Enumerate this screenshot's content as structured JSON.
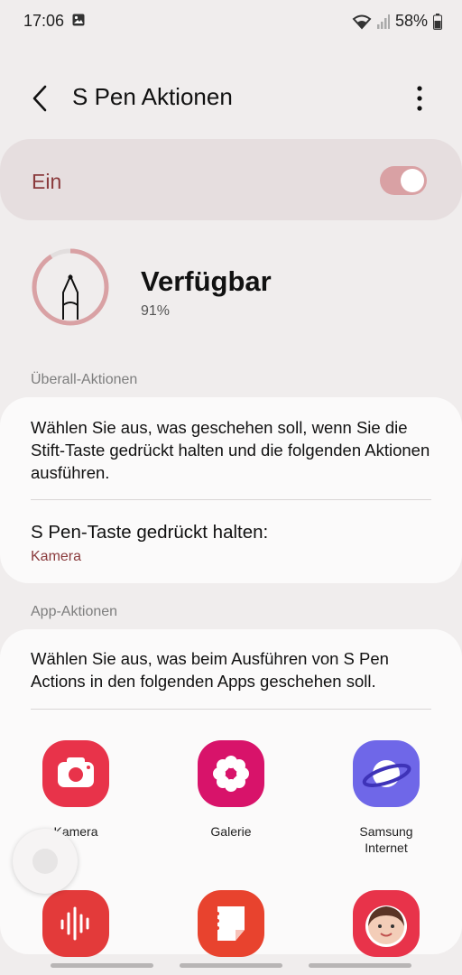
{
  "status": {
    "time": "17:06",
    "battery": "58%"
  },
  "header": {
    "title": "S Pen Aktionen"
  },
  "master": {
    "label": "Ein",
    "on": true
  },
  "availability": {
    "title": "Verfügbar",
    "percent": "91%"
  },
  "sections": {
    "anywhere": "Überall-Aktionen",
    "app": "App-Aktionen"
  },
  "anywhere_card": {
    "description": "Wählen Sie aus, was geschehen soll, wenn Sie die Stift-Taste gedrückt halten und die folgenden Aktionen ausführen.",
    "row_title": "S Pen-Taste gedrückt halten:",
    "row_value": "Kamera"
  },
  "app_card": {
    "description": "Wählen Sie aus, was beim Ausführen von S Pen Actions in den folgenden Apps geschehen soll.",
    "apps": [
      {
        "label": "Kamera",
        "icon": "camera-icon",
        "color": "#e8334a"
      },
      {
        "label": "Galerie",
        "icon": "flower-icon",
        "color": "#d8136a"
      },
      {
        "label": "Samsung\nInternet",
        "icon": "planet-icon",
        "color": "#6f67e8"
      },
      {
        "label": "",
        "icon": "voice-recorder-icon",
        "color": "#e33a3a"
      },
      {
        "label": "",
        "icon": "notes-icon",
        "color": "#e8432e"
      },
      {
        "label": "",
        "icon": "ar-emoji-icon",
        "color": "#e8334a"
      }
    ]
  },
  "colors": {
    "accent": "#8a3a3c",
    "toggle_on": "#d9a1a4",
    "background": "#f0eded"
  }
}
